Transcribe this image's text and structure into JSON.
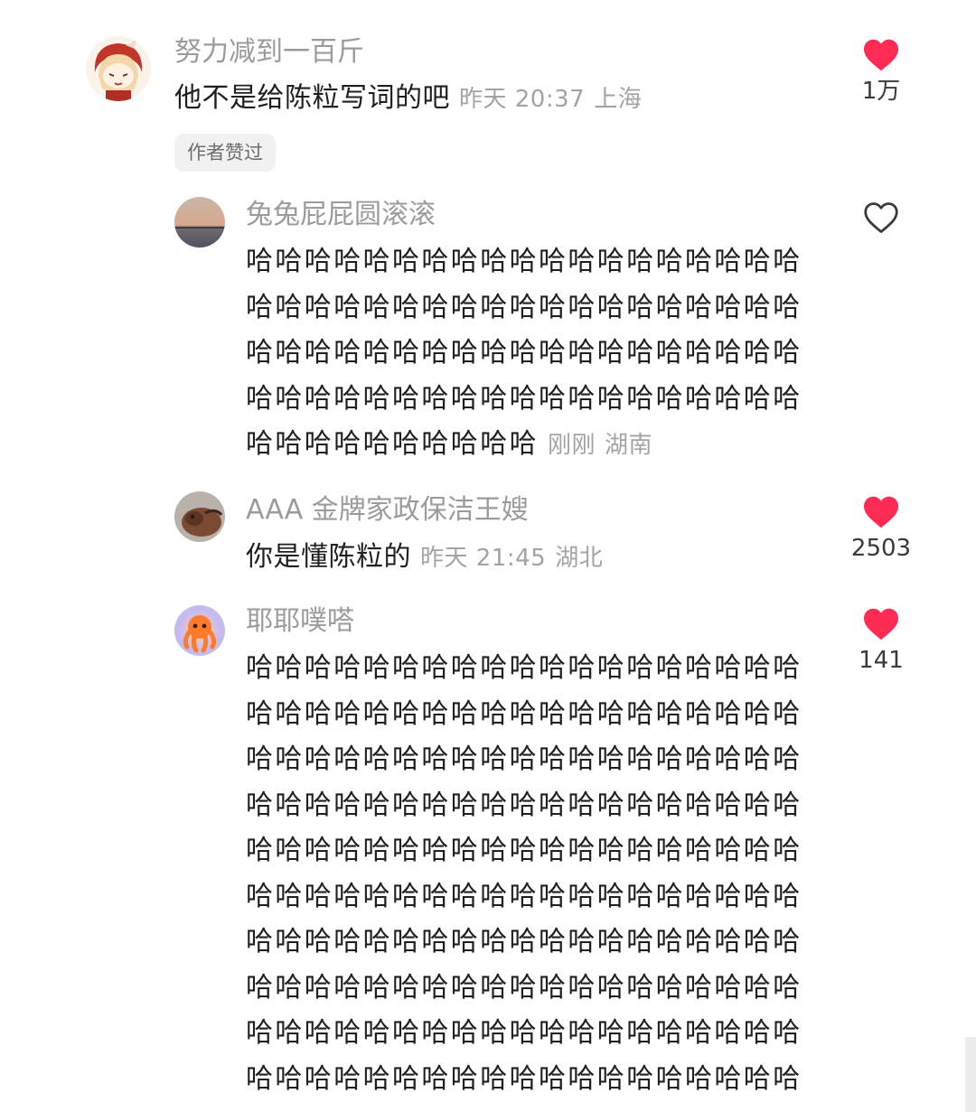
{
  "comments": [
    {
      "username": "努力减到一百斤",
      "lines": [
        "他不是给陈粒写词的吧"
      ],
      "time": "昨天 20:37",
      "location": "上海",
      "badge": "作者赞过",
      "likes": "1万",
      "liked": true
    },
    {
      "username": "兔兔屁屁圆滚滚",
      "lines": [
        "哈哈哈哈哈哈哈哈哈哈哈哈哈哈哈哈哈哈哈",
        "哈哈哈哈哈哈哈哈哈哈哈哈哈哈哈哈哈哈哈",
        "哈哈哈哈哈哈哈哈哈哈哈哈哈哈哈哈哈哈哈",
        "哈哈哈哈哈哈哈哈哈哈哈哈哈哈哈哈哈哈哈",
        "哈哈哈哈哈哈哈哈哈哈"
      ],
      "time": "刚刚",
      "location": "湖南",
      "likes": "",
      "liked": false
    },
    {
      "username": "AAA 金牌家政保洁王嫂",
      "lines": [
        "你是懂陈粒的"
      ],
      "time": "昨天 21:45",
      "location": "湖北",
      "likes": "2503",
      "liked": true
    },
    {
      "username": "耶耶噗嗒",
      "lines": [
        "哈哈哈哈哈哈哈哈哈哈哈哈哈哈哈哈哈哈哈",
        "哈哈哈哈哈哈哈哈哈哈哈哈哈哈哈哈哈哈哈",
        "哈哈哈哈哈哈哈哈哈哈哈哈哈哈哈哈哈哈哈",
        "哈哈哈哈哈哈哈哈哈哈哈哈哈哈哈哈哈哈哈",
        "哈哈哈哈哈哈哈哈哈哈哈哈哈哈哈哈哈哈哈",
        "哈哈哈哈哈哈哈哈哈哈哈哈哈哈哈哈哈哈哈",
        "哈哈哈哈哈哈哈哈哈哈哈哈哈哈哈哈哈哈哈",
        "哈哈哈哈哈哈哈哈哈哈哈哈哈哈哈哈哈哈哈",
        "哈哈哈哈哈哈哈哈哈哈哈哈哈哈哈哈哈哈哈",
        "哈哈哈哈哈哈哈哈哈哈哈哈哈哈哈哈哈哈哈"
      ],
      "likes": "141",
      "liked": true
    }
  ],
  "colors": {
    "like_red": "#fe2c55",
    "meta_gray": "#a3a3a3",
    "username_gray": "#9b9b9b"
  },
  "icons": {
    "like_filled": "heart-filled-icon",
    "like_outline": "heart-outline-icon"
  }
}
